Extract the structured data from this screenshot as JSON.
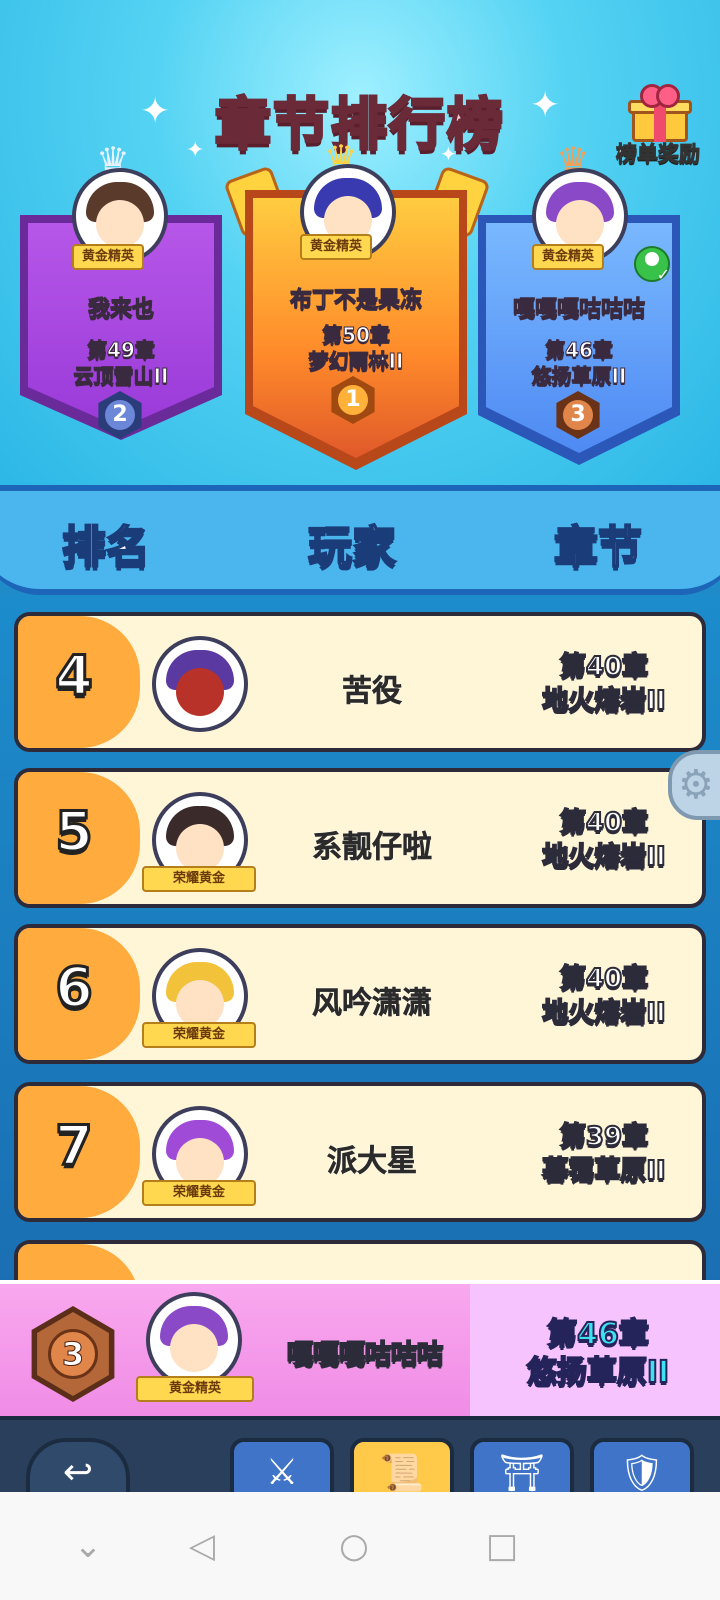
{
  "title": "章节排行榜",
  "reward_button_label": "榜单奖励",
  "podium": {
    "first": {
      "rank": "1",
      "badge": "黄金精英",
      "name": "布丁不是果冻",
      "chapter": "第50章",
      "stage": "梦幻雨林II"
    },
    "second": {
      "rank": "2",
      "badge": "黄金精英",
      "name": "我来也",
      "chapter": "第49章",
      "stage": "云顶雪山II"
    },
    "third": {
      "rank": "3",
      "badge": "黄金精英",
      "name": "嘎嘎嘎咕咕咕",
      "chapter": "第46章",
      "stage": "悠扬草原II"
    }
  },
  "headers": {
    "rank": "排名",
    "player": "玩家",
    "chapter": "章节"
  },
  "rows": [
    {
      "rank": "4",
      "name": "苦役",
      "badge": "",
      "chapter": "第40章",
      "stage": "地火熔岩II"
    },
    {
      "rank": "5",
      "name": "系靓仔啦",
      "badge": "荣耀黄金",
      "chapter": "第40章",
      "stage": "地火熔岩II"
    },
    {
      "rank": "6",
      "name": "风吟潇潇",
      "badge": "荣耀黄金",
      "chapter": "第40章",
      "stage": "地火熔岩II"
    },
    {
      "rank": "7",
      "name": "派大星",
      "badge": "荣耀黄金",
      "chapter": "第39章",
      "stage": "暮霭草原II"
    }
  ],
  "my_rank": {
    "rank": "3",
    "badge": "黄金精英",
    "name": "嘎嘎嘎咕咕咕",
    "chapter": "第46章",
    "stage": "悠扬草原II"
  },
  "colors": {
    "first": "#ff8a2a",
    "second": "#9a3ad9",
    "third": "#4f8af3",
    "row_rank": "#ffab3d"
  }
}
